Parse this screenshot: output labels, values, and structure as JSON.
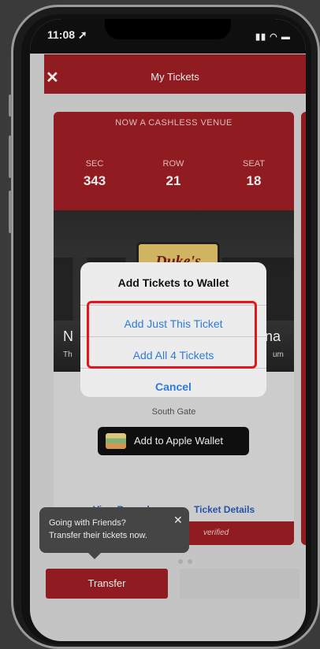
{
  "status_bar": {
    "time": "11:08 ➚",
    "signal": "▮▮ ◠ ▬"
  },
  "header": {
    "title": "My Tickets",
    "close_label": "✕"
  },
  "ticket": {
    "banner": "NOW A CASHLESS VENUE",
    "sec_label": "SEC",
    "sec": "343",
    "row_label": "ROW",
    "row": "21",
    "seat_label": "SEAT",
    "seat": "18",
    "logo_text": "Duke's",
    "side_left": "N",
    "side_right": "na",
    "sub_left": "Th",
    "sub_right": "um",
    "gate": "South Gate",
    "wallet_button": "Add to Apple Wallet",
    "view_barcode": "View Barcode",
    "ticket_details": "Ticket Details",
    "verified": "verified"
  },
  "tooltip": {
    "line1": "Going with Friends?",
    "line2": "Transfer their tickets now.",
    "close": "✕"
  },
  "bottom": {
    "transfer": "Transfer"
  },
  "alert": {
    "title": "Add Tickets to Wallet",
    "option_one": "Add Just This Ticket",
    "option_all": "Add All 4 Tickets",
    "cancel": "Cancel"
  },
  "colors": {
    "brand_red": "#9d1f24",
    "link_blue": "#2f7ad8",
    "highlight_red": "#e8141c"
  },
  "icons": [
    "close-icon",
    "wallet-icon",
    "location-arrow-icon",
    "signal-icon",
    "wifi-icon",
    "battery-icon"
  ]
}
